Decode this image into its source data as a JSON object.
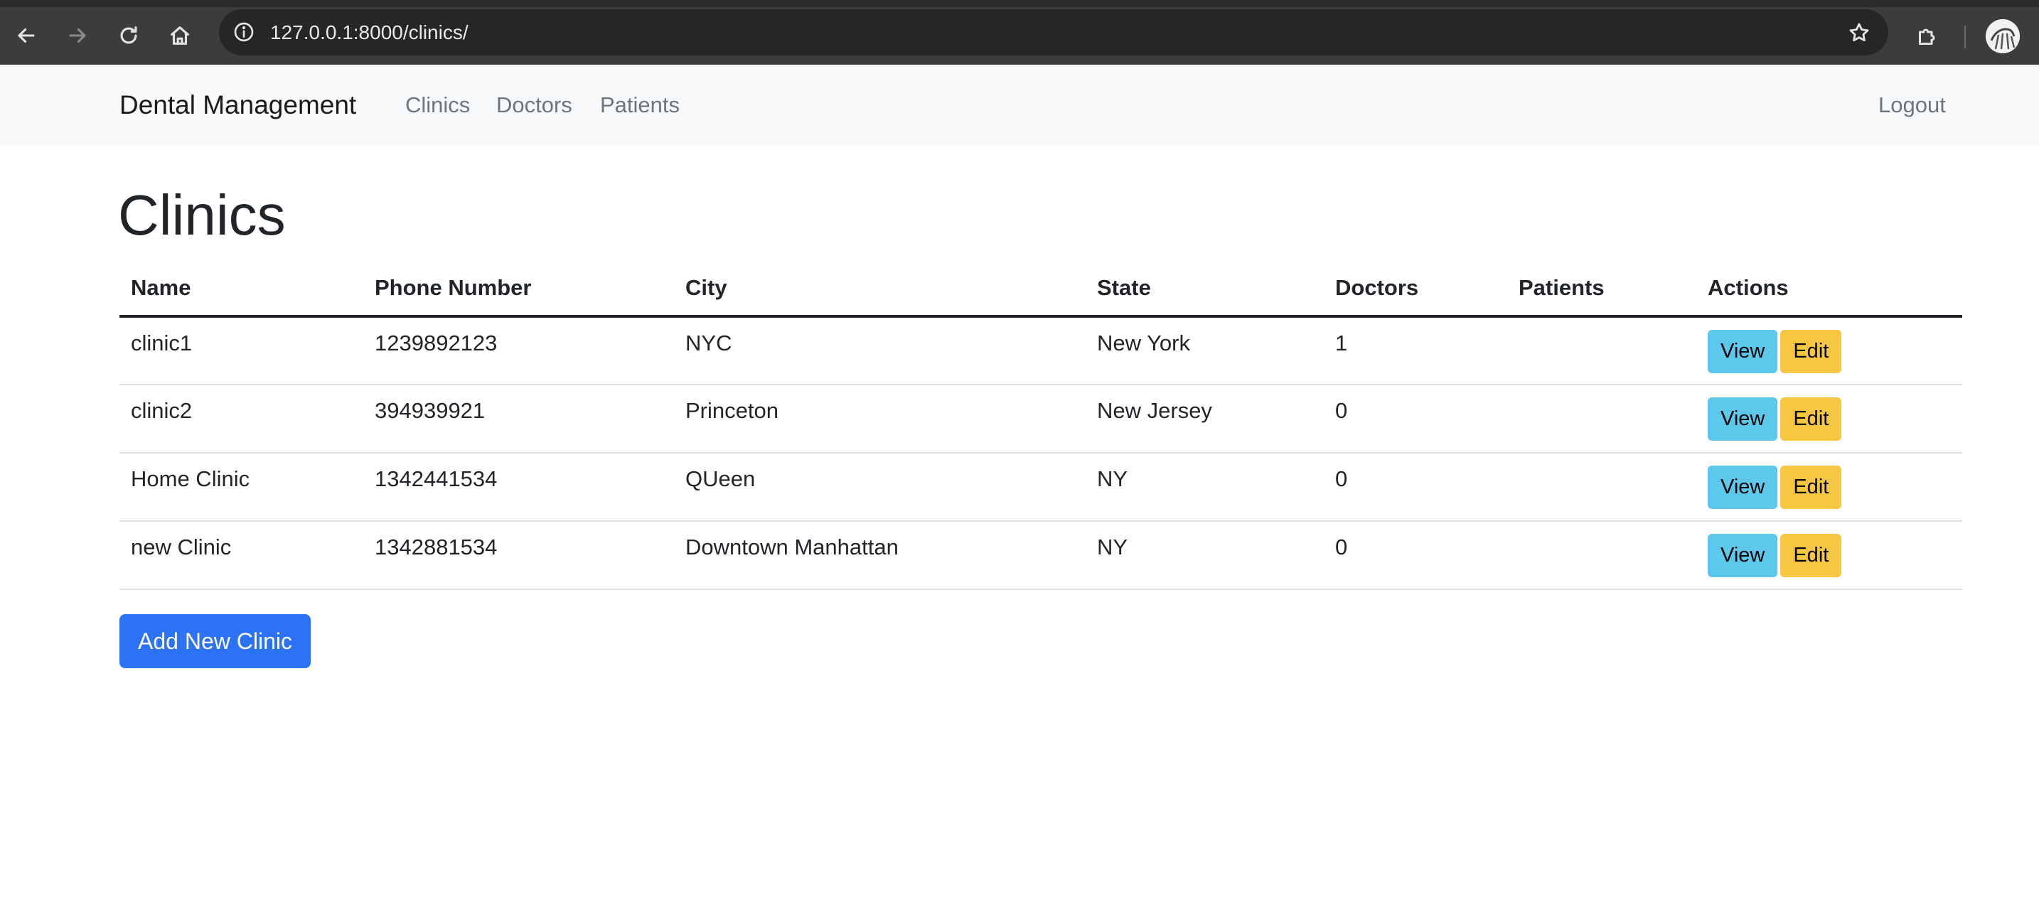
{
  "browser": {
    "url": "127.0.0.1:8000/clinics/",
    "icons": [
      "back-icon",
      "forward-icon",
      "reload-icon",
      "home-icon",
      "info-icon",
      "star-icon",
      "extensions-icon",
      "profile-avatar"
    ]
  },
  "navbar": {
    "brand": "Dental Management",
    "links": [
      "Clinics",
      "Doctors",
      "Patients"
    ],
    "logout": "Logout"
  },
  "page": {
    "title": "Clinics"
  },
  "table": {
    "headers": [
      "Name",
      "Phone Number",
      "City",
      "State",
      "Doctors",
      "Patients",
      "Actions"
    ],
    "rows": [
      {
        "name": "clinic1",
        "phone": "1239892123",
        "city": "NYC",
        "state": "New York",
        "doctors": "1",
        "patients": ""
      },
      {
        "name": "clinic2",
        "phone": "394939921",
        "city": "Princeton",
        "state": "New Jersey",
        "doctors": "0",
        "patients": ""
      },
      {
        "name": "Home Clinic",
        "phone": "1342441534",
        "city": "QUeen",
        "state": "NY",
        "doctors": "0",
        "patients": ""
      },
      {
        "name": "new Clinic",
        "phone": "1342881534",
        "city": "Downtown Manhattan",
        "state": "NY",
        "doctors": "0",
        "patients": ""
      }
    ],
    "view_label": "View",
    "edit_label": "Edit"
  },
  "add_button": "Add New Clinic",
  "colors": {
    "view_button": "#5bc8ec",
    "edit_button": "#f7c744",
    "primary_button": "#2b72f5",
    "navbar_bg": "#f8f9fa",
    "browser_bar": "#3c3c3c"
  }
}
